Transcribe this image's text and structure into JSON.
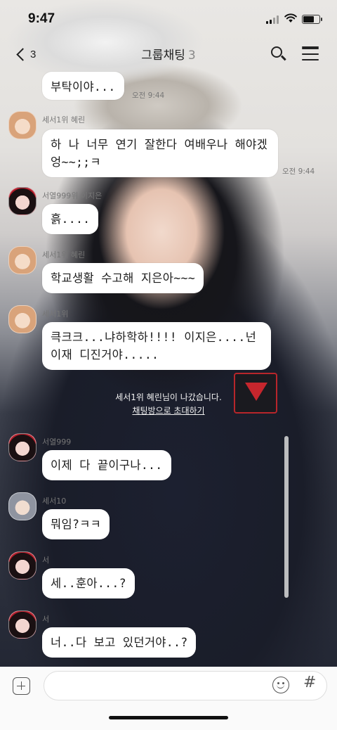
{
  "status_bar": {
    "time": "9:47"
  },
  "header": {
    "back_count": "3",
    "title": "그룹채팅",
    "member_count": "3"
  },
  "messages": [
    {
      "type": "bubble",
      "text": "부탁이야...",
      "time": "오전 9:44"
    },
    {
      "type": "bubble",
      "sender": "세서1위 혜린",
      "text": "하 나 너무 연기 잘한다 여배우나 해야겠엉~~;;ㅋ",
      "time": "오전 9:44"
    },
    {
      "type": "bubble",
      "sender": "서열999위 이지은",
      "text": "흙...."
    },
    {
      "type": "bubble",
      "sender": "세서1위 혜린",
      "text": "학교생활 수고해 지은아~~~"
    },
    {
      "type": "bubble",
      "sender": "세서1위",
      "text": "큭크크...냐하학하!!!! 이지은....넌 이재 디진거야....."
    },
    {
      "type": "system",
      "text": "세서1위 혜린님이 나갔습니다.",
      "link": "채팅방으로 초대하기"
    },
    {
      "type": "bubble",
      "sender": "서열999",
      "text": "이제 다 끝이구나..."
    },
    {
      "type": "bubble",
      "sender": "세서10",
      "text": "뭐임?ㅋㅋ"
    },
    {
      "type": "bubble",
      "sender": "서",
      "text": "세..훈아...?"
    },
    {
      "type": "bubble",
      "sender": "서",
      "text": "너..다 보고 있던거야..?"
    }
  ],
  "input": {
    "value": "",
    "placeholder": ""
  },
  "icons": {
    "back": "chevron-left-icon",
    "search": "search-icon",
    "menu": "menu-icon",
    "attach": "plus-square-icon",
    "emoji": "emoji-icon",
    "hash": "hash-icon"
  }
}
